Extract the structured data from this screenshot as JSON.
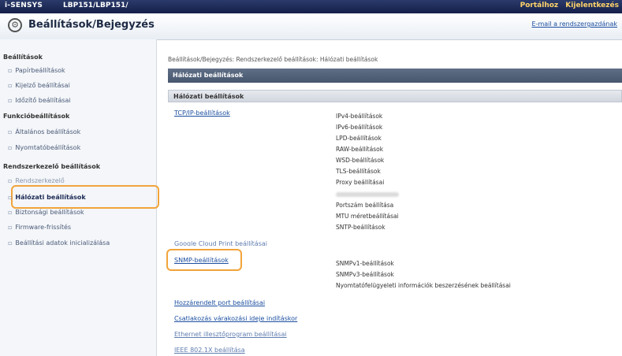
{
  "topbar": {
    "brand": "i-SENSYS",
    "model": "LBP151/LBP151/",
    "portal": "Portálhoz",
    "logout": "Kijelentkezés"
  },
  "header": {
    "title": "Beállítások/Bejegyzés",
    "mail_link": "E-mail a rendszergazdának"
  },
  "sidebar": {
    "sections": [
      {
        "title": "Beállítások",
        "items": [
          "Papírbeállítások",
          "Kijelző beállításai",
          "Időzítő beállításai"
        ]
      },
      {
        "title": "Funkcióbeállítások",
        "items": [
          "Általános beállítások",
          "Nyomtatóbeállítások"
        ]
      },
      {
        "title": "Rendszerkezelő beállítások",
        "items": [
          "Rendszerkezelő",
          "Hálózati beállítások",
          "Biztonsági beállítások",
          "Firmware-frissítés",
          "Beállítási adatok inicializálása"
        ]
      }
    ]
  },
  "main": {
    "breadcrumb": "Beállítások/Bejegyzés: Rendszerkezelő beállítások: Hálózati beállítások",
    "bar_title": "Hálózati beállítások",
    "section_title": "Hálózati beállítások",
    "tcpip": {
      "link": "TCP/IP-beállítások",
      "subitems": [
        "IPv4-beállítások",
        "IPv6-beállítások",
        "LPD-beállítások",
        "RAW-beállítások",
        "WSD-beállítások",
        "TLS-beállítások",
        "Proxy beállításai",
        "Portszám beállítása",
        "MTU méretbeállításai",
        "SNTP-beállítások"
      ]
    },
    "partial_link": "Google Cloud Print beállításai",
    "snmp": {
      "link": "SNMP-beállítások",
      "subitems": [
        "SNMPv1-beállítások",
        "SNMPv3-beállítások",
        "Nyomtatófelügyeleti információk beszerzésének beállításai"
      ]
    },
    "links": [
      "Hozzárendelt port beállításai",
      "Csatlakozás várakozási ideje indításkor",
      "Ethernet illesztőprogram beállításai",
      "IEEE 802.1X beállítása"
    ]
  },
  "colors": {
    "topbar": "#1b2750",
    "highlight": "#f2a43a",
    "link": "#1c4fa0"
  }
}
